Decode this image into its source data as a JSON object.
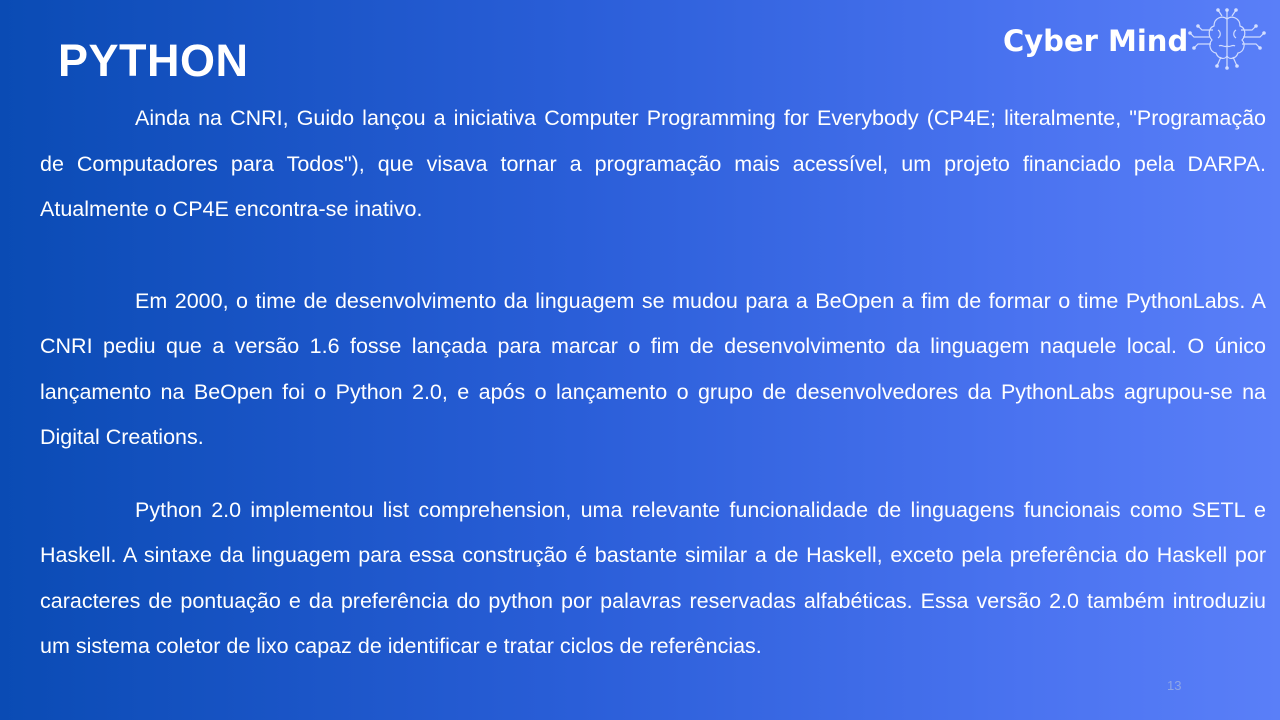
{
  "slide": {
    "title": "PYTHON",
    "page_number": "13"
  },
  "logo": {
    "text": "Cyber Mind",
    "icon": "brain-circuit-icon"
  },
  "paragraphs": [
    "Ainda na CNRI, Guido lançou a iniciativa Computer Programming for Everybody (CP4E; literalmente, \"Programação de Computadores para Todos\"), que visava tornar a programação mais acessível, um projeto financiado pela DARPA.  Atualmente o CP4E encontra-se inativo.",
    "Em 2000, o time de desenvolvimento da linguagem se mudou para a BeOpen a fim de formar o time PythonLabs. A CNRI pediu que a versão 1.6 fosse lançada para marcar o fim de desenvolvimento da linguagem naquele local. O único lançamento na BeOpen foi o Python 2.0, e após o lançamento o grupo de desenvolvedores da PythonLabs agrupou-se na Digital Creations.",
    "Python 2.0 implementou list comprehension, uma relevante funcionalidade de linguagens funcionais como SETL e Haskell. A sintaxe da linguagem para essa construção é bastante similar a de Haskell, exceto pela preferência do Haskell por caracteres de pontuação e da preferência do python por palavras reservadas alfabéticas. Essa versão 2.0 também introduziu um sistema coletor de lixo capaz de identificar e tratar ciclos de referências."
  ],
  "colors": {
    "background_start": "#0a4bb4",
    "background_end": "#5a7ff8",
    "text": "#ffffff"
  }
}
